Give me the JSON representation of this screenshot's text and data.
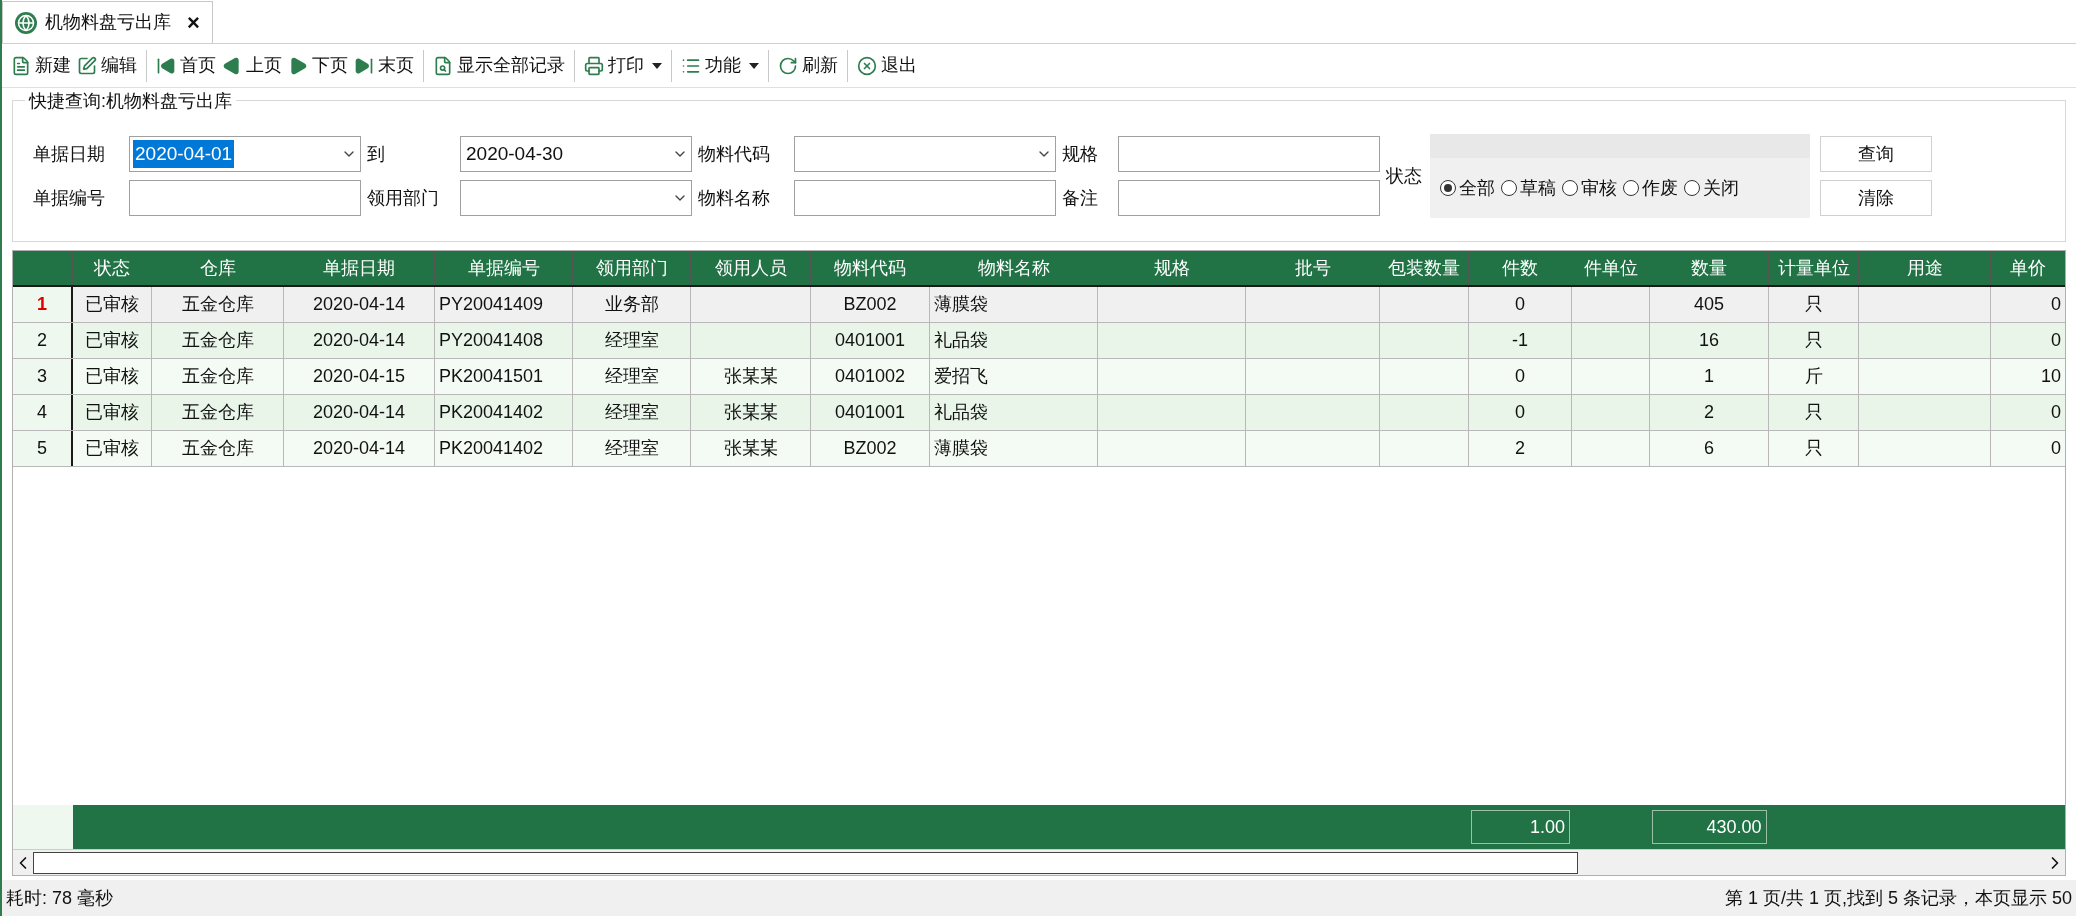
{
  "tab": {
    "title": "机物料盘亏出库",
    "close": "×"
  },
  "toolbar": [
    [
      {
        "kind": "new",
        "label": "新建",
        "dropdown": false
      },
      {
        "kind": "edit",
        "label": "编辑",
        "dropdown": false
      }
    ],
    [
      {
        "kind": "first",
        "label": "首页",
        "dropdown": false
      },
      {
        "kind": "prev",
        "label": "上页",
        "dropdown": false
      },
      {
        "kind": "next",
        "label": "下页",
        "dropdown": false
      },
      {
        "kind": "last",
        "label": "末页",
        "dropdown": false
      }
    ],
    [
      {
        "kind": "showall",
        "label": "显示全部记录",
        "dropdown": false
      }
    ],
    [
      {
        "kind": "print",
        "label": "打印",
        "dropdown": true
      }
    ],
    [
      {
        "kind": "list",
        "label": "功能",
        "dropdown": true
      }
    ],
    [
      {
        "kind": "refresh",
        "label": "刷新",
        "dropdown": false
      }
    ],
    [
      {
        "kind": "exit",
        "label": "退出",
        "dropdown": false
      }
    ]
  ],
  "query": {
    "title": "快捷查询:机物料盘亏出库",
    "date_from": {
      "label": "单据日期",
      "value": "2020-04-01"
    },
    "date_to": {
      "label": "到",
      "value": "2020-04-30"
    },
    "material_code": {
      "label": "物料代码"
    },
    "spec": {
      "label": "规格"
    },
    "doc_no": {
      "label": "单据编号"
    },
    "department": {
      "label": "领用部门"
    },
    "material_name": {
      "label": "物料名称"
    },
    "remark": {
      "label": "备注"
    },
    "status": {
      "label": "状态",
      "options": [
        {
          "label": "全部",
          "selected": true
        },
        {
          "label": "草稿",
          "selected": false
        },
        {
          "label": "审核",
          "selected": false
        },
        {
          "label": "作废",
          "selected": false
        },
        {
          "label": "关闭",
          "selected": false
        }
      ]
    },
    "buttons": [
      "查询",
      "清除"
    ]
  },
  "table": {
    "columns": [
      "状态",
      "仓库",
      "单据日期",
      "单据编号",
      "领用部门",
      "领用人员",
      "物料代码",
      "物料名称",
      "规格",
      "批号",
      "包装数量",
      "件数",
      "件单位",
      "数量",
      "计量单位",
      "用途",
      "单价"
    ],
    "rows": [
      {
        "number": "1",
        "selected": true,
        "cells": [
          "已审核",
          "五金仓库",
          "2020-04-14",
          "PY20041409",
          "业务部",
          "",
          "BZ002",
          "薄膜袋",
          "",
          "",
          "",
          "0",
          "",
          "405",
          "只",
          "",
          "0"
        ]
      },
      {
        "number": "2",
        "selected": false,
        "cells": [
          "已审核",
          "五金仓库",
          "2020-04-14",
          "PY20041408",
          "经理室",
          "",
          "0401001",
          "礼品袋",
          "",
          "",
          "",
          "-1",
          "",
          "16",
          "只",
          "",
          "0"
        ]
      },
      {
        "number": "3",
        "selected": false,
        "cells": [
          "已审核",
          "五金仓库",
          "2020-04-15",
          "PK20041501",
          "经理室",
          "张某某",
          "0401002",
          "爱招飞",
          "",
          "",
          "",
          "0",
          "",
          "1",
          "斤",
          "",
          "10"
        ]
      },
      {
        "number": "4",
        "selected": false,
        "cells": [
          "已审核",
          "五金仓库",
          "2020-04-14",
          "PK20041402",
          "经理室",
          "张某某",
          "0401001",
          "礼品袋",
          "",
          "",
          "",
          "0",
          "",
          "2",
          "只",
          "",
          "0"
        ]
      },
      {
        "number": "5",
        "selected": false,
        "cells": [
          "已审核",
          "五金仓库",
          "2020-04-14",
          "PK20041402",
          "经理室",
          "张某某",
          "BZ002",
          "薄膜袋",
          "",
          "",
          "",
          "2",
          "",
          "6",
          "只",
          "",
          "0"
        ]
      }
    ],
    "totals": {
      "pieces": "1.00",
      "quantity": "430.00"
    }
  },
  "status_bar": {
    "elapsed": "耗时: 78 毫秒",
    "paging": "第 1 页/共 1 页,找到 5 条记录，本页显示 50"
  }
}
